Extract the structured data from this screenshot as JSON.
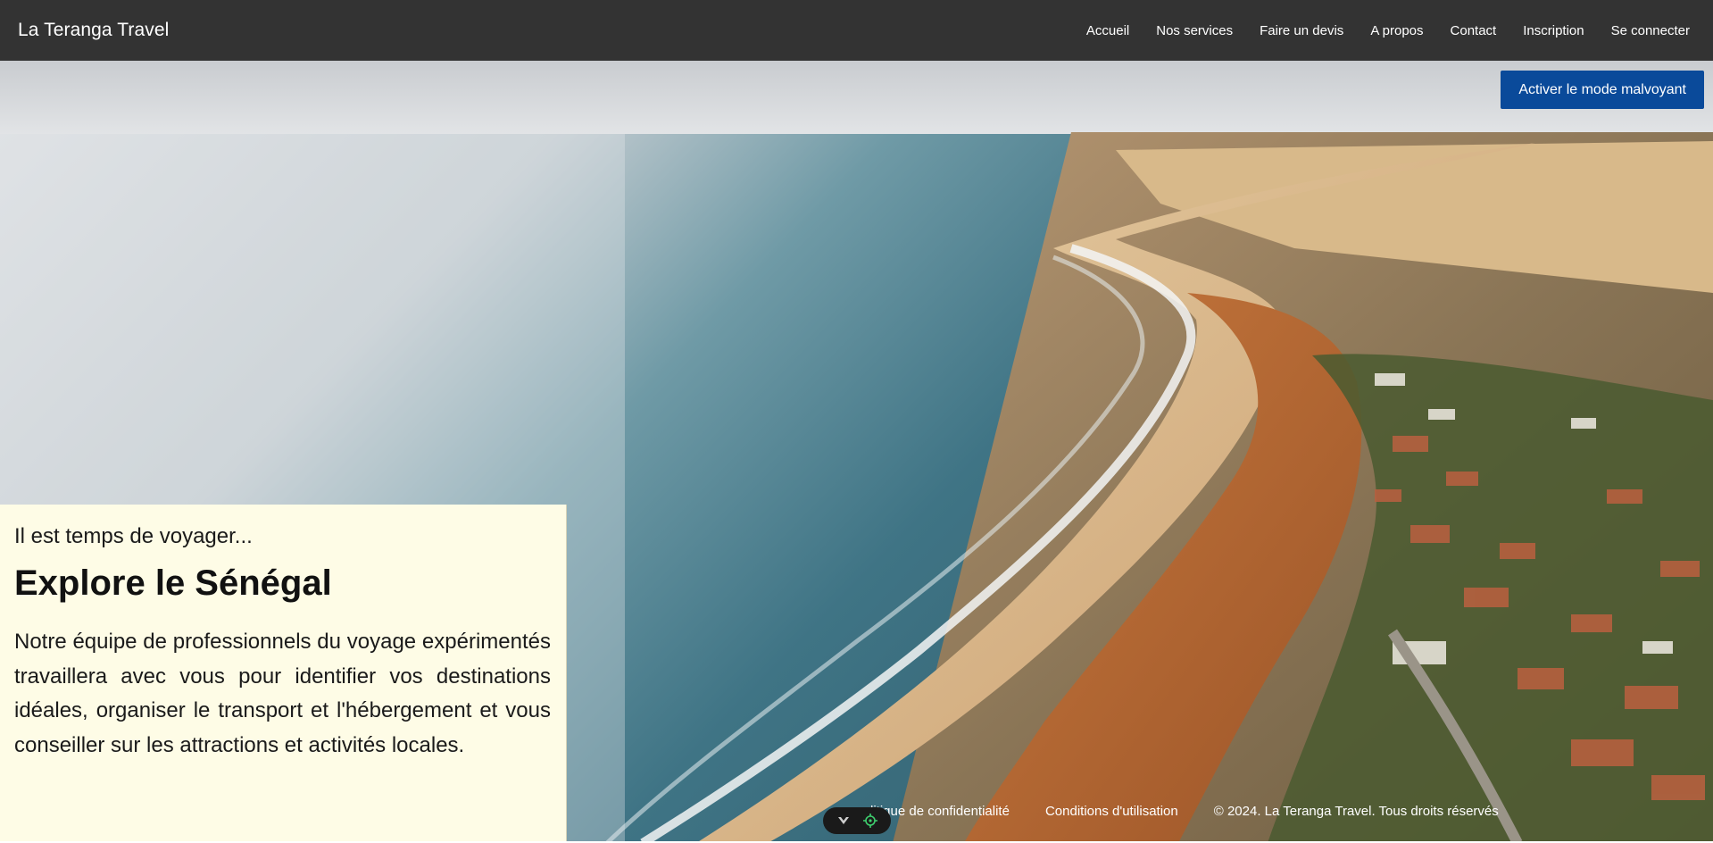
{
  "navbar": {
    "brand": "La Teranga Travel",
    "links": [
      "Accueil",
      "Nos services",
      "Faire un devis",
      "A propos",
      "Contact",
      "Inscription",
      "Se connecter"
    ]
  },
  "accessibility": {
    "toggle_label": "Activer le mode malvoyant",
    "button_color": "#0a4a9a"
  },
  "hero": {
    "image_description_icon": "coastline-photo",
    "tagline": "Il est temps de voyager...",
    "title": "Explore le Sénégal",
    "text": "Notre équipe de professionnels du voyage expérimentés travaillera avec vous pour identifier vos destinations idéales, organiser le transport et l'hébergement et vous conseiller sur les attractions et activités locales."
  },
  "footer": {
    "privacy": "litique de confidentialité",
    "terms": "Conditions d'utilisation",
    "copyright": "© 2024. La Teranga Travel. Tous droits réservés"
  },
  "widget": {
    "icons": [
      "chevron-down-icon",
      "target-icon"
    ]
  },
  "colors": {
    "navbar": "#333333",
    "panel": "#fefce6",
    "sea": "#4a8294",
    "sand": "#d9a878"
  }
}
